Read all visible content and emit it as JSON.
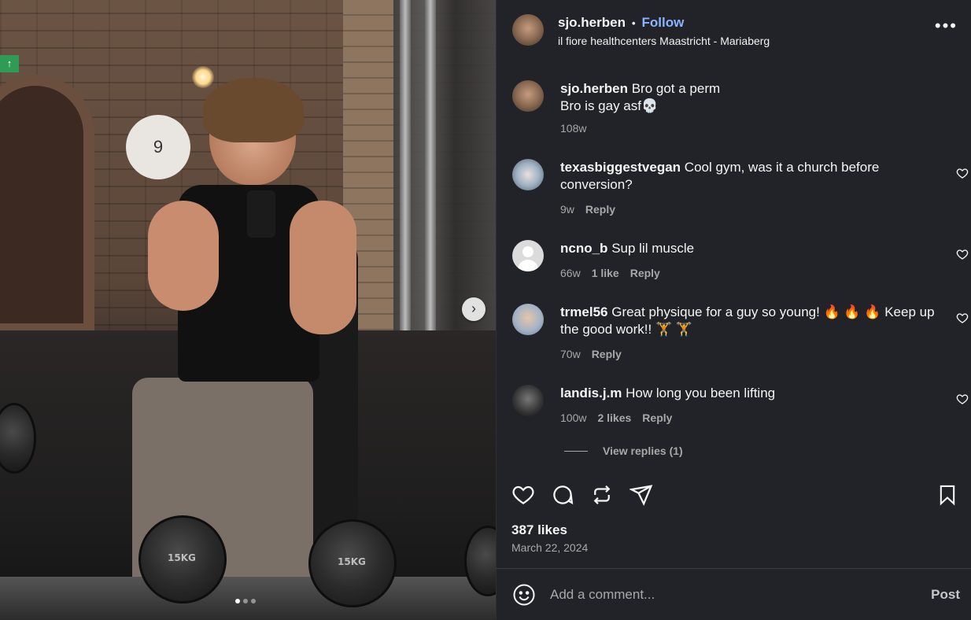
{
  "post": {
    "username": "sjo.herben",
    "follow_label": "Follow",
    "separator": "•",
    "location": "il fiore healthcenters Maastricht - Mariaberg",
    "more_label": "•••"
  },
  "photo": {
    "carousel_next": "›",
    "exit_sign": "↑",
    "logo_text": "9",
    "dumbbell_label_1": "15KG",
    "dumbbell_label_2": "15KG"
  },
  "caption": {
    "username": "sjo.herben",
    "line1": "Bro got a perm",
    "line2": "Bro is gay asf💀",
    "time": "108w"
  },
  "comments": [
    {
      "username": "texasbiggestvegan",
      "text": "Cool gym, was it a church before conversion?",
      "time": "9w",
      "likes": "",
      "reply": "Reply"
    },
    {
      "username": "ncno_b",
      "text": "Sup lil muscle",
      "time": "66w",
      "likes": "1 like",
      "reply": "Reply"
    },
    {
      "username": "trmel56",
      "text": "Great physique for a guy so young! 🔥 🔥 🔥 Keep up the good work!! 🏋 🏋",
      "time": "70w",
      "likes": "",
      "reply": "Reply"
    },
    {
      "username": "landis.j.m",
      "text": "How long you been lifting",
      "time": "100w",
      "likes": "2 likes",
      "reply": "Reply"
    }
  ],
  "view_replies": "View replies (1)",
  "likes": "387 likes",
  "date": "March 22, 2024",
  "composer": {
    "placeholder": "Add a comment...",
    "post_label": "Post"
  }
}
